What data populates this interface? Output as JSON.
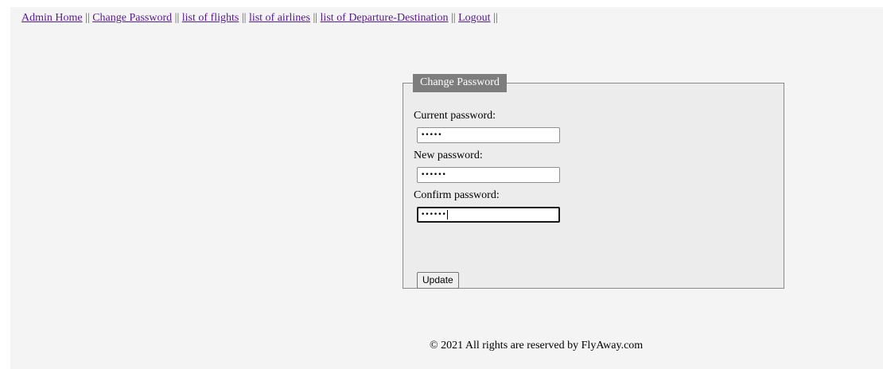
{
  "nav": {
    "items": [
      {
        "label": "Admin Home"
      },
      {
        "label": "Change Password"
      },
      {
        "label": "list of flights"
      },
      {
        "label": "list of airlines"
      },
      {
        "label": "list of Departure-Destination"
      },
      {
        "label": "Logout"
      }
    ],
    "separator": "||"
  },
  "form": {
    "legend": "Change Password",
    "current_label": "Current password:",
    "current_value": "•••••",
    "new_label": "New password:",
    "new_value": "••••••",
    "confirm_label": "Confirm password:",
    "confirm_value": "••••••",
    "submit_label": "Update"
  },
  "footer": {
    "text": "© 2021 All rights are reserved by FlyAway.com"
  },
  "colors": {
    "background": "#f4f4f4",
    "fieldset_background": "#ececec",
    "legend_background": "#7d7d7d",
    "link": "#551a8b"
  }
}
